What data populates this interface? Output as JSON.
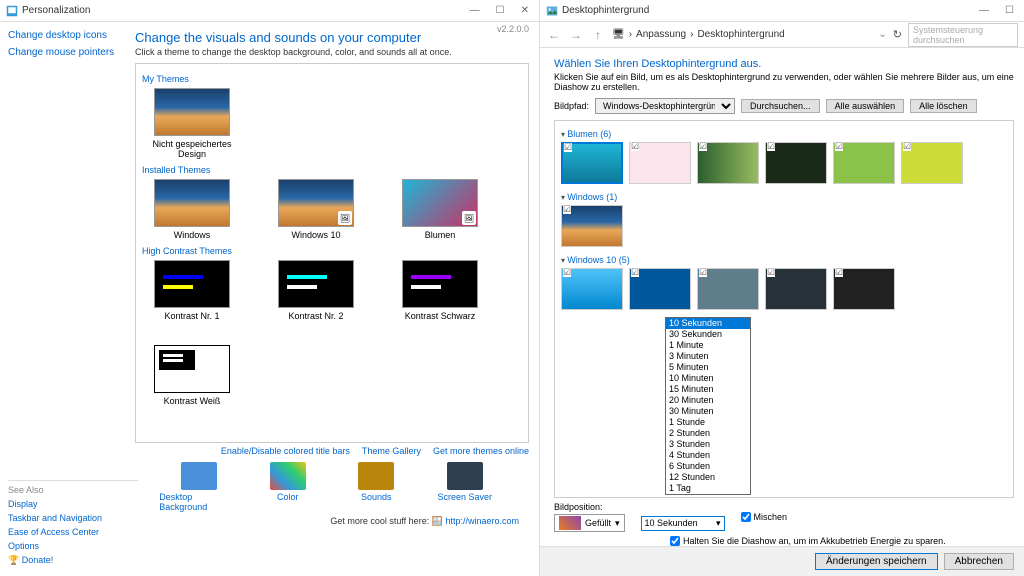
{
  "left": {
    "title": "Personalization",
    "version": "v2.2.0.0",
    "sidebar": {
      "links": [
        "Change desktop icons",
        "Change mouse pointers"
      ],
      "seeAlso": "See Also",
      "bottomLinks": [
        "Display",
        "Taskbar and Navigation",
        "Ease of Access Center",
        "Options"
      ],
      "donate": "Donate!"
    },
    "heading": "Change the visuals and sounds on your computer",
    "sub": "Click a theme to change the desktop background, color, and sounds all at once.",
    "sections": {
      "my": "My Themes",
      "installed": "Installed Themes",
      "hc": "High Contrast Themes"
    },
    "themes": {
      "my": [
        {
          "label": "Nicht gespeichertes Design",
          "cls": "win"
        }
      ],
      "installed": [
        {
          "label": "Windows",
          "cls": "win"
        },
        {
          "label": "Windows 10",
          "cls": "win",
          "badge": true
        },
        {
          "label": "Blumen",
          "cls": "flower",
          "badge": true
        }
      ],
      "hc": [
        {
          "label": "Kontrast Nr. 1",
          "cls": "hc1"
        },
        {
          "label": "Kontrast Nr. 2",
          "cls": "hc2"
        },
        {
          "label": "Kontrast Schwarz",
          "cls": "hcb"
        },
        {
          "label": "Kontrast Weiß",
          "cls": "hcw"
        }
      ]
    },
    "links": [
      "Enable/Disable colored title bars",
      "Theme Gallery",
      "Get more themes online"
    ],
    "bottom": [
      {
        "label": "Desktop Background",
        "cls": ""
      },
      {
        "label": "Color",
        "cls": "color"
      },
      {
        "label": "Sounds",
        "cls": "sound"
      },
      {
        "label": "Screen Saver",
        "cls": "scr"
      }
    ],
    "cool": "Get more cool stuff here:",
    "coolUrl": "http://winaero.com"
  },
  "right": {
    "title": "Desktophintergrund",
    "breadcrumb": [
      "Anpassung",
      "Desktophintergrund"
    ],
    "searchPlaceholder": "Systemsteuerung durchsuchen",
    "heading": "Wählen Sie Ihren Desktophintergrund aus.",
    "sub": "Klicken Sie auf ein Bild, um es als Desktophintergrund zu verwenden, oder wählen Sie mehrere Bilder aus, um eine Diashow zu erstellen.",
    "pathLabel": "Bildpfad:",
    "pathValue": "Windows-Desktophintergründe",
    "buttons": {
      "browse": "Durchsuchen...",
      "selectAll": "Alle auswählen",
      "clearAll": "Alle löschen"
    },
    "sections": [
      {
        "title": "Blumen (6)",
        "thumbs": [
          "teal",
          "pink",
          "green",
          "dark",
          "lime",
          "yellow"
        ]
      },
      {
        "title": "Windows (1)",
        "thumbs": [
          "win10"
        ]
      },
      {
        "title": "Windows 10 (5)",
        "thumbs": [
          "blue1",
          "blue2",
          "rock",
          "night",
          "road"
        ]
      }
    ],
    "intervals": [
      "10 Sekunden",
      "30 Sekunden",
      "1 Minute",
      "3 Minuten",
      "5 Minuten",
      "10 Minuten",
      "15 Minuten",
      "20 Minuten",
      "30 Minuten",
      "1 Stunde",
      "2 Stunden",
      "3 Stunden",
      "4 Stunden",
      "6 Stunden",
      "12 Stunden",
      "1 Tag"
    ],
    "positionLabel": "Bildposition:",
    "positionValue": "Gefüllt",
    "intervalSelected": "10 Sekunden",
    "shuffle": "Mischen",
    "batterySave": "Halten Sie die Diashow an, um im Akkubetrieb Energie zu sparen.",
    "save": "Änderungen speichern",
    "cancel": "Abbrechen"
  }
}
